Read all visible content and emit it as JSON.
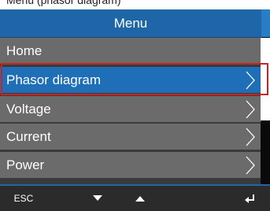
{
  "top_text": "Menu (phasor diagram)",
  "menu": {
    "title": "Menu",
    "items": [
      {
        "label": "Home",
        "has_arrow": false,
        "selected": false
      },
      {
        "label": "Phasor diagram",
        "has_arrow": true,
        "selected": true
      },
      {
        "label": "Voltage",
        "has_arrow": true,
        "selected": false
      },
      {
        "label": "Current",
        "has_arrow": true,
        "selected": false
      },
      {
        "label": "Power",
        "has_arrow": true,
        "selected": false
      }
    ]
  },
  "softkeys": {
    "esc_label": "ESC",
    "down_icon": "triangle-down-icon",
    "up_icon": "triangle-up-icon",
    "enter_icon": "enter-return-icon"
  },
  "colors": {
    "title_bar": "#1e66a8",
    "item_bg": "#6b6b6b",
    "selected_bg": "#1f6fb8",
    "highlight_frame": "#cc2222"
  }
}
